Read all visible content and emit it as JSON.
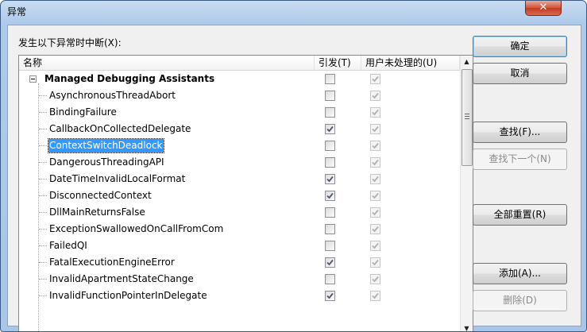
{
  "window": {
    "title": "异常",
    "close_symbol": "✕"
  },
  "caption": "发生以下异常时中断(X):",
  "columns": {
    "name": "名称",
    "thrown": "引发(T)",
    "unhandled": "用户未处理的(U)"
  },
  "group": {
    "label": "Managed Debugging Assistants",
    "thrown": false,
    "unhandled": true
  },
  "rows": [
    {
      "label": "AsynchronousThreadAbort",
      "thrown": false,
      "unhandled": true,
      "selected": false
    },
    {
      "label": "BindingFailure",
      "thrown": false,
      "unhandled": true,
      "selected": false
    },
    {
      "label": "CallbackOnCollectedDelegate",
      "thrown": true,
      "unhandled": true,
      "selected": false
    },
    {
      "label": "ContextSwitchDeadlock",
      "thrown": false,
      "unhandled": true,
      "selected": true
    },
    {
      "label": "DangerousThreadingAPI",
      "thrown": false,
      "unhandled": true,
      "selected": false
    },
    {
      "label": "DateTimeInvalidLocalFormat",
      "thrown": true,
      "unhandled": true,
      "selected": false
    },
    {
      "label": "DisconnectedContext",
      "thrown": true,
      "unhandled": true,
      "selected": false
    },
    {
      "label": "DllMainReturnsFalse",
      "thrown": false,
      "unhandled": true,
      "selected": false
    },
    {
      "label": "ExceptionSwallowedOnCallFromCom",
      "thrown": false,
      "unhandled": true,
      "selected": false
    },
    {
      "label": "FailedQI",
      "thrown": false,
      "unhandled": true,
      "selected": false
    },
    {
      "label": "FatalExecutionEngineError",
      "thrown": true,
      "unhandled": true,
      "selected": false
    },
    {
      "label": "InvalidApartmentStateChange",
      "thrown": false,
      "unhandled": true,
      "selected": false
    },
    {
      "label": "InvalidFunctionPointerInDelegate",
      "thrown": true,
      "unhandled": true,
      "selected": false
    }
  ],
  "buttons": {
    "ok": "确定",
    "cancel": "取消",
    "find": "查找(F)...",
    "find_next": "查找下一个(N)",
    "reset_all": "全部重置(R)",
    "add": "添加(A)...",
    "delete": "删除(D)"
  },
  "colors": {
    "selection": "#3399ff",
    "check": "#4a5a70",
    "check_disabled": "#b0b0b0"
  }
}
